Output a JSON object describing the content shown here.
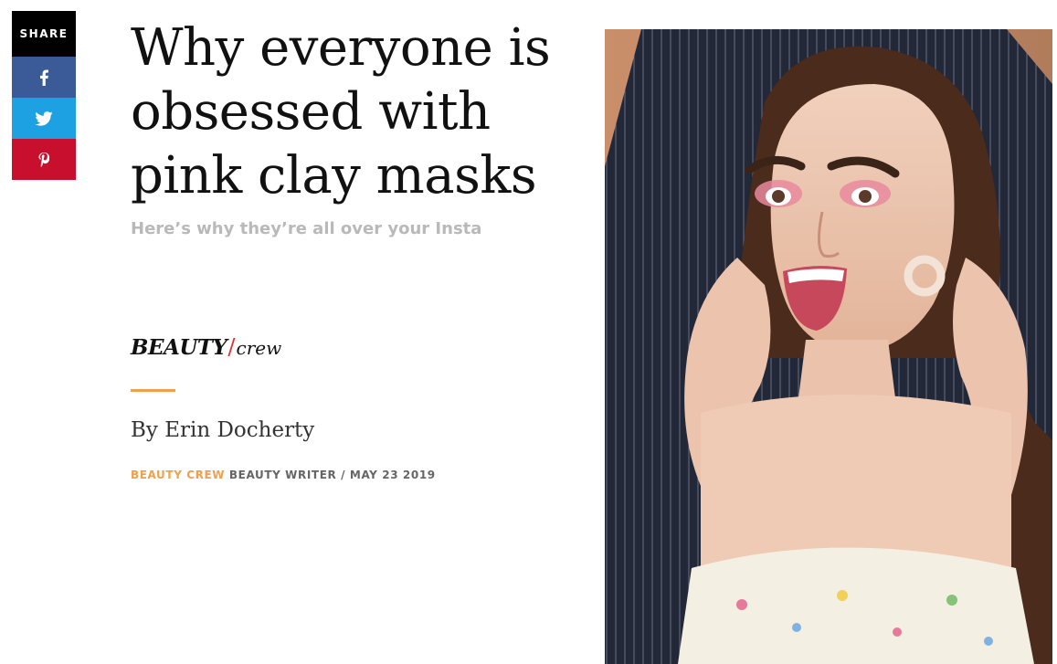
{
  "share": {
    "title": "SHARE",
    "buttons": [
      {
        "network": "facebook",
        "icon": "facebook-icon",
        "color": "#3b5b98"
      },
      {
        "network": "twitter",
        "icon": "twitter-icon",
        "color": "#1da1e2"
      },
      {
        "network": "pinterest",
        "icon": "pinterest-icon",
        "color": "#c8102e"
      }
    ]
  },
  "article": {
    "headline": "Why everyone is obsessed with pink clay masks",
    "subhead": "Here’s why they’re all over your Insta",
    "brand": {
      "part1": "BEAUTY",
      "separator": "/",
      "part2": "crew"
    },
    "byline": "By Erin Docherty",
    "meta": {
      "role": "BEAUTY CREW",
      "title": "BEAUTY WRITER",
      "separator": "/",
      "date": "MAY 23 2019"
    }
  },
  "hero_image": {
    "description_icon": "woman-photo",
    "accent": "#f1a049"
  }
}
